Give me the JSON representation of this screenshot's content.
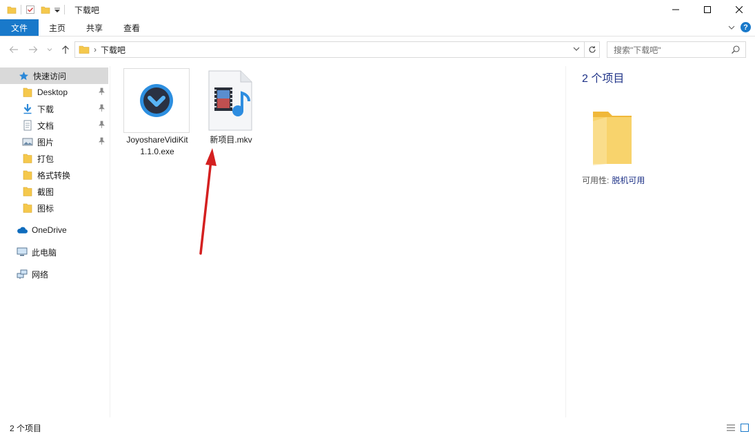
{
  "window": {
    "title": "下载吧"
  },
  "ribbon": {
    "tabs": [
      "文件",
      "主页",
      "共享",
      "查看"
    ]
  },
  "address": {
    "path": "下载吧",
    "separator": "›"
  },
  "search": {
    "placeholder": "搜索\"下载吧\""
  },
  "sidebar": {
    "quick_access": "快速访问",
    "items": [
      {
        "label": "Desktop",
        "icon": "folder-icon",
        "pinned": true
      },
      {
        "label": "下载",
        "icon": "download-arrow-icon",
        "pinned": true
      },
      {
        "label": "文档",
        "icon": "document-icon",
        "pinned": true
      },
      {
        "label": "图片",
        "icon": "picture-icon",
        "pinned": true
      },
      {
        "label": "打包",
        "icon": "folder-icon",
        "pinned": false
      },
      {
        "label": "格式转换",
        "icon": "folder-icon",
        "pinned": false
      },
      {
        "label": "截图",
        "icon": "folder-icon",
        "pinned": false
      },
      {
        "label": "图标",
        "icon": "folder-icon",
        "pinned": false
      }
    ],
    "onedrive": "OneDrive",
    "this_pc": "此电脑",
    "network": "网络"
  },
  "files": [
    {
      "name": "JoyoshareVidiKit1.1.0.exe",
      "icon": "joyoshare-app-icon"
    },
    {
      "name": "新项目.mkv",
      "icon": "video-file-icon"
    }
  ],
  "details": {
    "count": "2 个项目",
    "availability_label": "可用性:",
    "availability_value": "脱机可用"
  },
  "status": {
    "count": "2 个项目"
  },
  "colors": {
    "accent": "#1979ca",
    "folder": "#f5c84c",
    "arrow": "#d42020"
  }
}
